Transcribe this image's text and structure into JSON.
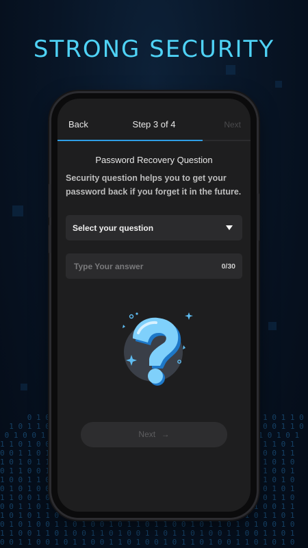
{
  "headline": "STRONG SECURITY",
  "topbar": {
    "back_label": "Back",
    "step_label": "Step 3 of 4",
    "next_label": "Next"
  },
  "progress": {
    "current_step": 3,
    "total_steps": 4
  },
  "section": {
    "title": "Password Recovery Question",
    "description": "Security question helps you to get your password back if you forget it in the future."
  },
  "question_select": {
    "label": "Select your question",
    "icon": "caret-down-icon"
  },
  "answer_field": {
    "value": "",
    "placeholder": "Type Your answer",
    "counter": "0/30"
  },
  "illustration": {
    "icon": "question-mark-icon"
  },
  "footer": {
    "next_label": "Next",
    "next_icon": "arrow-right-icon",
    "next_arrow": "→"
  },
  "colors": {
    "accent": "#2f9fe6",
    "headline": "#4fd2f5",
    "screen_bg": "#1e1e1f",
    "field_bg": "#2b2b2d"
  }
}
